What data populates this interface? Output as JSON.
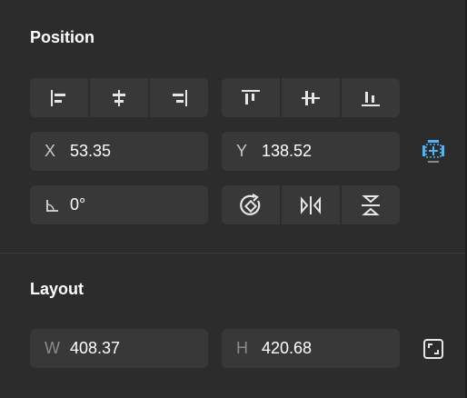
{
  "position": {
    "title": "Position",
    "x_label": "X",
    "x_value": "53.35",
    "y_label": "Y",
    "y_value": "138.52",
    "rotation_value": "0°"
  },
  "layout": {
    "title": "Layout",
    "w_label": "W",
    "w_value": "408.37",
    "h_label": "H",
    "h_value": "420.68"
  },
  "icons": {
    "align_left": "align-left-icon",
    "align_h_center": "align-horizontal-center-icon",
    "align_right": "align-right-icon",
    "align_top": "align-top-icon",
    "align_v_center": "align-vertical-center-icon",
    "align_bottom": "align-bottom-icon",
    "constraints": "constraints-icon",
    "rotation": "angle-icon",
    "rotate_90": "rotate-icon",
    "flip_h": "flip-horizontal-icon",
    "flip_v": "flip-vertical-icon",
    "resize": "resize-to-fit-icon"
  },
  "colors": {
    "panel_bg": "#2c2c2c",
    "field_bg": "#383838",
    "accent": "#4db4f5"
  }
}
